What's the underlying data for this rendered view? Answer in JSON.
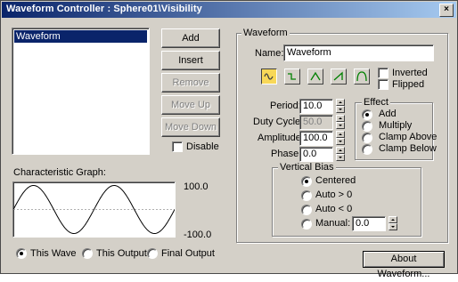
{
  "window": {
    "title": "Waveform Controller : Sphere01\\Visibility",
    "close_glyph": "×"
  },
  "left_panel": {
    "list_items": [
      "Waveform"
    ],
    "buttons": {
      "add": "Add",
      "insert": "Insert",
      "remove": "Remove",
      "move_up": "Move Up",
      "move_down": "Move Down"
    },
    "disable_label": "Disable",
    "disable_checked": false,
    "graph_label": "Characteristic Graph:",
    "graph_max": "100.0",
    "graph_min": "-100.0",
    "graph_modes": [
      {
        "label": "This Wave",
        "selected": true
      },
      {
        "label": "This Output",
        "selected": false
      },
      {
        "label": "Final Output",
        "selected": false
      }
    ]
  },
  "waveform": {
    "group_label": "Waveform",
    "name_label": "Name:",
    "name_value": "Waveform",
    "shape_buttons": [
      "sine-wave-icon",
      "square-wave-icon",
      "triangle-wave-icon",
      "sawtooth-wave-icon",
      "half-sine-wave-icon"
    ],
    "inverted_label": "Inverted",
    "flipped_label": "Flipped",
    "period_label": "Period:",
    "period_value": "10.0",
    "duty_label": "Duty Cycle:",
    "duty_value": "50.0",
    "amplitude_label": "Amplitude:",
    "amplitude_value": "100.0",
    "phase_label": "Phase:",
    "phase_value": "0.0"
  },
  "effect": {
    "group_label": "Effect",
    "options": [
      {
        "label": "Add",
        "selected": true
      },
      {
        "label": "Multiply",
        "selected": false
      },
      {
        "label": "Clamp Above",
        "selected": false
      },
      {
        "label": "Clamp Below",
        "selected": false
      }
    ]
  },
  "vertical_bias": {
    "group_label": "Vertical Bias",
    "options": [
      {
        "label": "Centered",
        "selected": true
      },
      {
        "label": "Auto > 0",
        "selected": false
      },
      {
        "label": "Auto < 0",
        "selected": false
      },
      {
        "label": "Manual:",
        "selected": false
      }
    ],
    "manual_value": "0.0"
  },
  "about_button": "About Waveform...",
  "colors": {
    "titlebar_start": "#0a246a",
    "titlebar_end": "#a6caf0",
    "active_shape": "#f8d858",
    "face": "#d4d0c8"
  }
}
